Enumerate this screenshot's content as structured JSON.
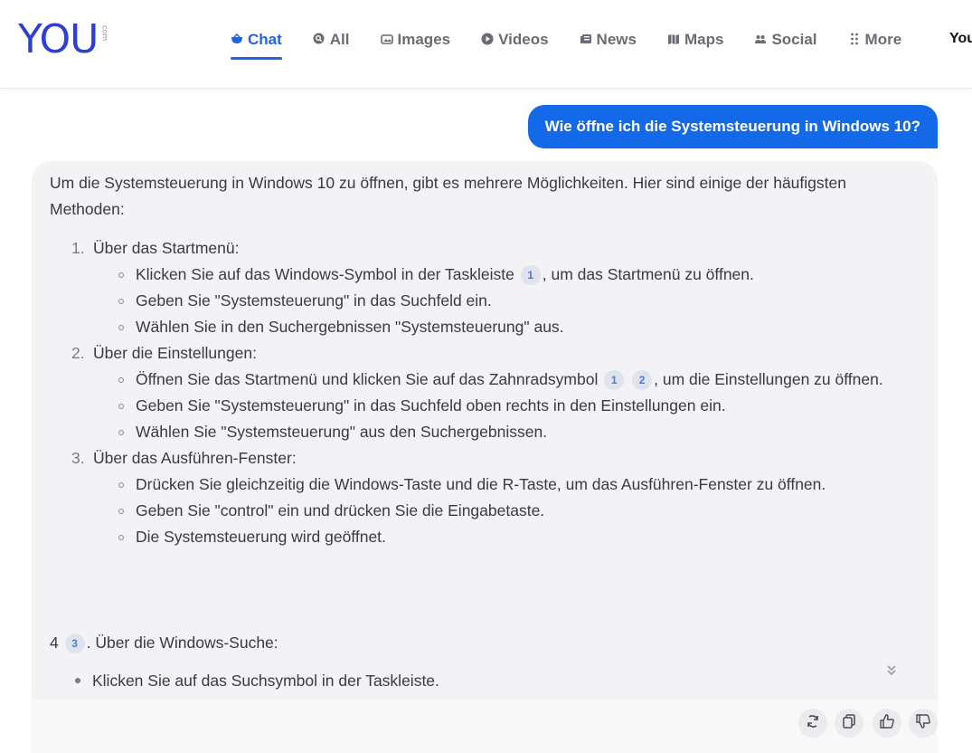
{
  "header": {
    "logo": "YOU",
    "logo_suffix": "com",
    "nav": [
      {
        "label": "Chat",
        "icon": "chat-icon",
        "active": true
      },
      {
        "label": "All",
        "icon": "search-icon"
      },
      {
        "label": "Images",
        "icon": "images-icon"
      },
      {
        "label": "Videos",
        "icon": "play-icon"
      },
      {
        "label": "News",
        "icon": "news-icon"
      },
      {
        "label": "Maps",
        "icon": "map-icon"
      },
      {
        "label": "Social",
        "icon": "people-icon"
      },
      {
        "label": "More",
        "icon": "dots-icon"
      }
    ],
    "user_label": "You"
  },
  "chat": {
    "user_message": "Wie öffne ich die Systemsteuerung in Windows 10?",
    "answer": {
      "intro": "Um die Systemsteuerung in Windows 10 zu öffnen, gibt es mehrere Möglichkeiten. Hier sind einige der häufigsten Methoden:",
      "items": [
        {
          "num": "1.",
          "label": "Über das Startmenü:",
          "subs": [
            {
              "before": "Klicken Sie auf das Windows-Symbol in der Taskleiste",
              "cites": [
                "1"
              ],
              "after": ", um das Startmenü zu öffnen."
            },
            {
              "before": "Geben Sie \"Systemsteuerung\" in das Suchfeld ein."
            },
            {
              "before": "Wählen Sie in den Suchergebnissen \"Systemsteuerung\" aus."
            }
          ]
        },
        {
          "num": "2.",
          "label": "Über die Einstellungen:",
          "subs": [
            {
              "before": "Öffnen Sie das Startmenü und klicken Sie auf das Zahnradsymbol",
              "cites": [
                "1",
                "2"
              ],
              "after": ", um die Einstellungen zu öffnen."
            },
            {
              "before": "Geben Sie \"Systemsteuerung\" in das Suchfeld oben rechts in den Einstellungen ein."
            },
            {
              "before": "Wählen Sie \"Systemsteuerung\" aus den Suchergebnissen."
            }
          ]
        },
        {
          "num": "3.",
          "label": "Über das Ausführen-Fenster:",
          "subs": [
            {
              "before": "Drücken Sie gleichzeitig die Windows-Taste und die R-Taste, um das Ausführen-Fenster zu öffnen."
            },
            {
              "before": "Geben Sie \"control\" ein und drücken Sie die Eingabetaste."
            },
            {
              "before": "Die Systemsteuerung wird geöffnet."
            }
          ]
        }
      ],
      "item4": {
        "num": "4",
        "cite": "3",
        "label": ". Über die Windows-Suche:"
      },
      "item4_bullet": "Klicken Sie auf das Suchsymbol in der Taskleiste."
    },
    "actions": [
      {
        "icon": "regenerate-icon"
      },
      {
        "icon": "copy-icon"
      },
      {
        "icon": "thumbs-up-icon"
      },
      {
        "icon": "thumbs-down-icon"
      }
    ]
  },
  "colors": {
    "accent": "#1e63ea",
    "user_bubble": "#1469e8",
    "logo": "#2d3fd9",
    "answer_bg": "#f3f3f5"
  }
}
